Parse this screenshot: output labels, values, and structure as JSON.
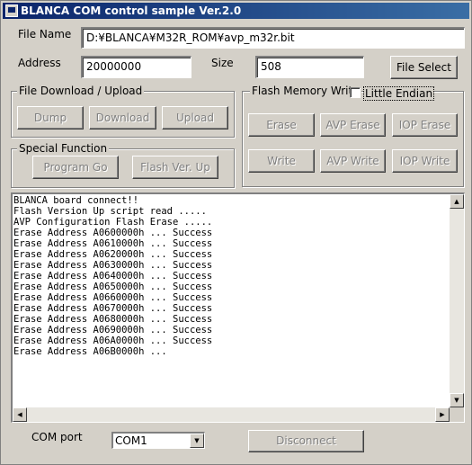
{
  "window": {
    "title": "BLANCA COM control sample  Ver.2.0"
  },
  "file": {
    "label": "File Name",
    "value": "D:¥BLANCA¥M32R_ROM¥avp_m32r.bit"
  },
  "address": {
    "label": "Address",
    "value": "20000000"
  },
  "size": {
    "label": "Size",
    "value": "508"
  },
  "file_select_label": "File Select",
  "download_group": {
    "title": "File Download / Upload",
    "dump": "Dump",
    "download": "Download",
    "upload": "Upload"
  },
  "special_group": {
    "title": "Special Function",
    "program_go": "Program Go",
    "flash_ver_up": "Flash Ver. Up"
  },
  "flash_group": {
    "title": "Flash Memory Write",
    "little_endian": "Little Endian",
    "erase": "Erase",
    "avp_erase": "AVP Erase",
    "iop_erase": "IOP Erase",
    "write": "Write",
    "avp_write": "AVP Write",
    "iop_write": "IOP Write"
  },
  "log": {
    "lines": [
      "BLANCA board connect!!",
      "Flash Version Up script read .....",
      "AVP Configuration Flash Erase .....",
      "Erase Address A0600000h ... Success",
      "Erase Address A0610000h ... Success",
      "Erase Address A0620000h ... Success",
      "Erase Address A0630000h ... Success",
      "Erase Address A0640000h ... Success",
      "Erase Address A0650000h ... Success",
      "Erase Address A0660000h ... Success",
      "Erase Address A0670000h ... Success",
      "Erase Address A0680000h ... Success",
      "Erase Address A0690000h ... Success",
      "Erase Address A06A0000h ... Success",
      "Erase Address A06B0000h ..."
    ]
  },
  "com": {
    "label": "COM port",
    "value": "COM1"
  },
  "disconnect_label": "Disconnect",
  "icons": {
    "app": "app-window-icon",
    "up": "scroll-up-arrow-icon",
    "down": "scroll-down-arrow-icon",
    "left": "scroll-left-arrow-icon",
    "right": "scroll-right-arrow-icon",
    "dropdown": "dropdown-arrow-icon"
  }
}
